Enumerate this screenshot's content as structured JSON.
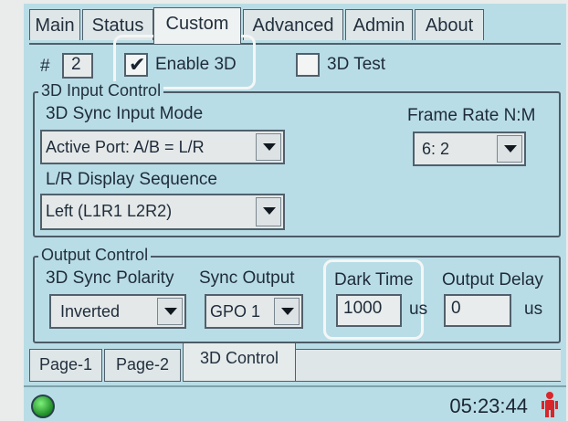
{
  "tabs": [
    {
      "label": "Main"
    },
    {
      "label": "Status"
    },
    {
      "label": "Custom"
    },
    {
      "label": "Advanced"
    },
    {
      "label": "Admin"
    },
    {
      "label": "About"
    }
  ],
  "header": {
    "number_label": "#",
    "number_value": "2",
    "enable_3d_label": "Enable 3D",
    "enable_3d_checked": true,
    "test_3d_label": "3D Test",
    "test_3d_checked": false
  },
  "input_control": {
    "title": "3D Input Control",
    "sync_mode_label": "3D Sync Input Mode",
    "sync_mode_value": "Active Port: A/B = L/R",
    "frame_rate_label": "Frame Rate N:M",
    "frame_rate_value": "6: 2",
    "lr_sequence_label": "L/R Display Sequence",
    "lr_sequence_value": "Left (L1R1 L2R2)"
  },
  "output_control": {
    "title": "Output Control",
    "polarity_label": "3D Sync Polarity",
    "polarity_value": "Inverted",
    "sync_output_label": "Sync Output",
    "sync_output_value": "GPO 1",
    "dark_time_label": "Dark Time",
    "dark_time_value": "1000",
    "dark_time_unit": "us",
    "output_delay_label": "Output Delay",
    "output_delay_value": "0",
    "output_delay_unit": "us"
  },
  "page_tabs": [
    {
      "label": "Page-1"
    },
    {
      "label": "Page-2"
    },
    {
      "label": "3D Control"
    }
  ],
  "status": {
    "clock": "05:23:44",
    "led_color": "#2fbf3a"
  }
}
